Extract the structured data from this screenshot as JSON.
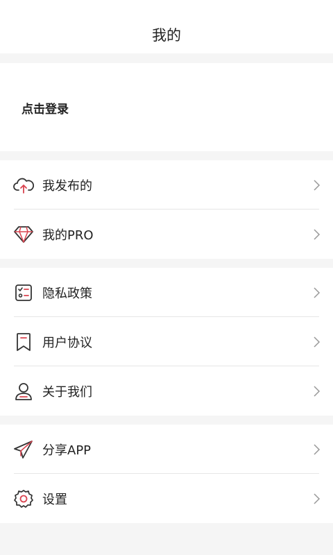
{
  "header": {
    "title": "我的"
  },
  "login": {
    "label": "点击登录"
  },
  "groups": [
    {
      "items": [
        {
          "label": "我发布的",
          "icon": "cloud-upload-icon"
        },
        {
          "label": "我的PRO",
          "icon": "diamond-icon"
        }
      ]
    },
    {
      "items": [
        {
          "label": "隐私政策",
          "icon": "checklist-icon"
        },
        {
          "label": "用户协议",
          "icon": "bookmark-icon"
        },
        {
          "label": "关于我们",
          "icon": "user-icon"
        }
      ]
    },
    {
      "items": [
        {
          "label": "分享APP",
          "icon": "paper-plane-icon"
        },
        {
          "label": "设置",
          "icon": "gear-icon"
        }
      ]
    }
  ],
  "colors": {
    "accent": "#d9434f",
    "background": "#f5f5f5",
    "card": "#ffffff"
  }
}
